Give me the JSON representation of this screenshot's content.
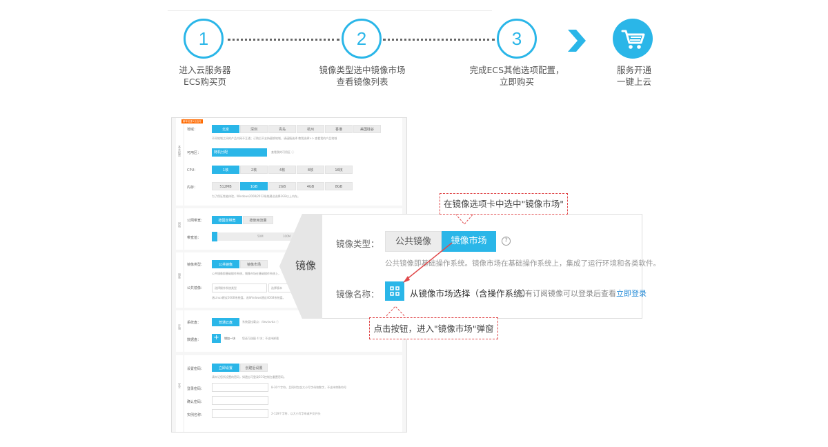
{
  "steps": [
    {
      "number": "1",
      "label_line1": "进入云服务器",
      "label_line2": "ECS购买页"
    },
    {
      "number": "2",
      "label_line1": "镜像类型选中镜像市场",
      "label_line2": "查看镜像列表"
    },
    {
      "number": "3",
      "label_line1": "完成ECS其他选项配置，",
      "label_line2": "立即购买"
    },
    {
      "number": "",
      "label_line1": "服务开通",
      "label_line2": "一键上云"
    }
  ],
  "icons": {
    "arrow": "chevron-right-icon",
    "cart": "shopping-cart-icon",
    "help": "question-circle-icon",
    "market": "grid-icon"
  },
  "colors": {
    "accent": "#2ab6e8",
    "annotation": "#e0484a",
    "link": "#2a8ed8"
  },
  "form": {
    "promo_tag": "新年优惠1元包月",
    "region_label": "地域：",
    "regions": [
      "北京",
      "深圳",
      "青岛",
      "杭州",
      "香港",
      "美国硅谷"
    ],
    "region_note": "不同地域之间的产品内网不互通；订购后不支持更换地域，请谨慎选择 教我选择>>  查看我的产品地域",
    "zone_label": "可用区：",
    "zone_value": "随机分配",
    "zone_note": "查看我的可用区 ⓘ",
    "cpu_label": "CPU：",
    "cpu_options": [
      "1核",
      "2核",
      "4核",
      "8核",
      "16核"
    ],
    "mem_label": "内存：",
    "mem_options": [
      "512MB",
      "1GB",
      "2GB",
      "4GB",
      "8GB"
    ],
    "mem_note": "为了保证性能体验，Windows2008/2012系统建议选择2GB以上内存。",
    "bw_type_label": "公网带宽：",
    "bw_types": [
      "按固定带宽",
      "按使用流量"
    ],
    "bw_label": "带宽值：",
    "bw_marks": [
      "50M",
      "100M"
    ],
    "image_type_label": "镜像类型：",
    "image_types": [
      "公共镜像",
      "镜像市场"
    ],
    "image_note": "公共镜像即基础操作系统，镜像市场在基础操作系统上，",
    "public_image_label": "公共镜像：",
    "public_image_value": "选择操作系统类型",
    "public_image_ver": "选择版本",
    "image_note2": "选Linux建议20GB系统盘，选Windows建议40GB系统盘。",
    "disk_label": "系统盘：",
    "disk_value": "普通云盘",
    "disk_note": "系统盘挂载点：/dev/xvda ⓘ",
    "data_disk_label": "数据盘：",
    "data_disk_add": "增加一块",
    "data_disk_note": "您还可选配 4 块；不支持卸载",
    "pwd_label": "设置密码：",
    "pwd_options": [
      "立即设置",
      "创建后设置"
    ],
    "pwd_note": "请牢记您所设置的密码，如遗忘可登录ECS控制台重置密码。",
    "login_pwd_label": "登录密码：",
    "login_pwd_note": "8-30个字符，且同时包含大小写字母和数字，不支持特殊符号",
    "confirm_pwd_label": "确认密码：",
    "instance_name_label": "实例名称：",
    "instance_name_note": "2-128个字符，以大小写字母或中文开头",
    "side_labels": [
      "基本配置",
      "网络",
      "镜像",
      "存储",
      "安全"
    ]
  },
  "callout": {
    "title": "镜像",
    "image_type_label": "镜像类型：",
    "tab_public": "公共镜像",
    "tab_market": "镜像市场",
    "help_glyph": "?",
    "description": "公共镜像即基础操作系统。镜像市场在基础操作系统上，集成了运行环境和各类软件。",
    "image_name_label": "镜像名称：",
    "market_select": "从镜像市场选择（含操作系统）",
    "login_hint": "如有订阅镜像可以登录后查看",
    "login_link": "立即登录"
  },
  "annotations": {
    "top": "在镜像选项卡中选中\"镜像市场\"",
    "bottom": "点击按钮，进入\"镜像市场\"弹窗"
  }
}
